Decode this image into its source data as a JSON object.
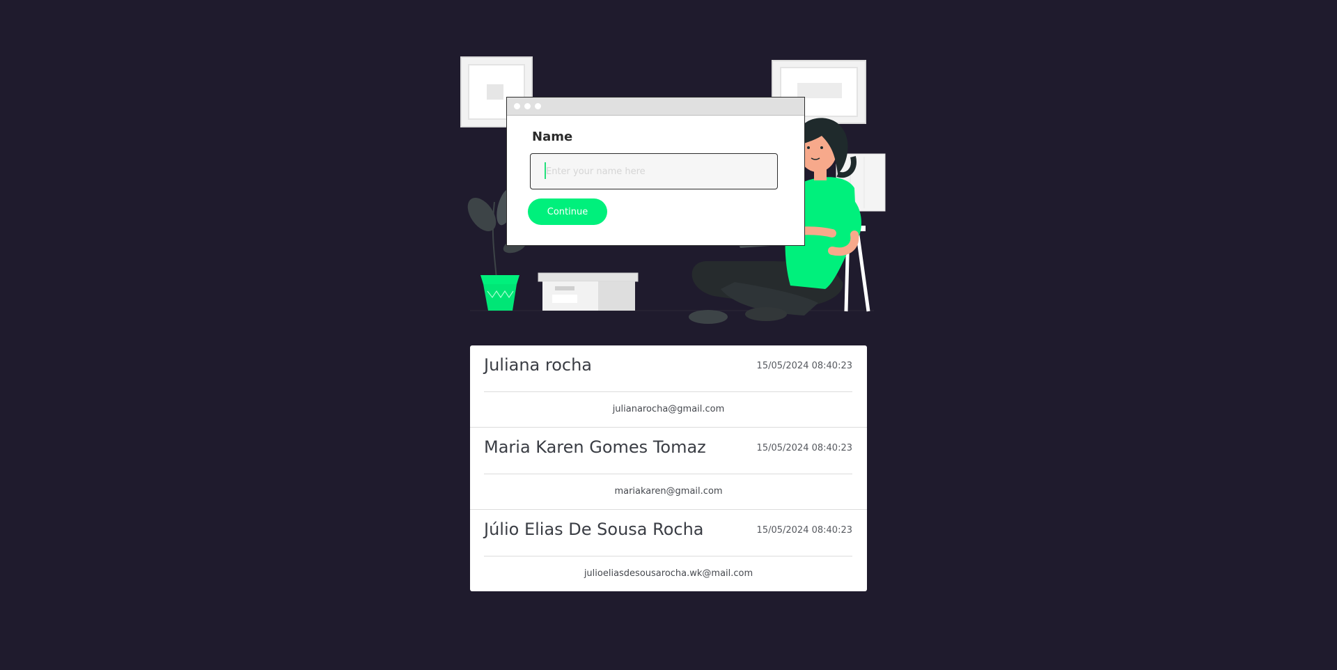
{
  "form": {
    "label": "Name",
    "input_placeholder": "Enter your name here",
    "input_value": "",
    "button_label": "Continue"
  },
  "entries": [
    {
      "name": "Juliana rocha",
      "date": "15/05/2024 08:40:23",
      "email": "julianarocha@gmail.com"
    },
    {
      "name": "Maria Karen Gomes Tomaz",
      "date": "15/05/2024 08:40:23",
      "email": "mariakaren@gmail.com"
    },
    {
      "name": "Júlio Elias De Sousa Rocha",
      "date": "15/05/2024 08:40:23",
      "email": "julioeliasdesousarocha.wk@mail.com"
    }
  ],
  "colors": {
    "background": "#1f1b2d",
    "accent": "#00f07c",
    "card": "#ffffff"
  }
}
